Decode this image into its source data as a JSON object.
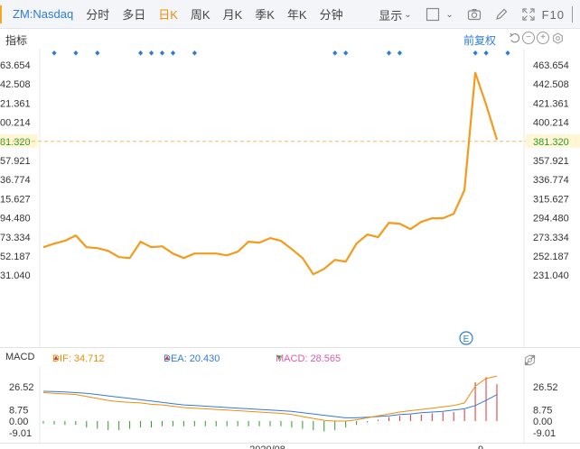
{
  "toolbar": {
    "symbol": "ZM:Nasdaq",
    "periods": [
      "分时",
      "多日",
      "日K",
      "周K",
      "月K",
      "季K",
      "年K",
      "分钟"
    ],
    "active_period": "日K",
    "show_label": "显示",
    "f10_label": "F10"
  },
  "indicator_row": {
    "label": "指标",
    "adjust_label": "前复权"
  },
  "price_axis": {
    "right_labels": [
      "463.654",
      "442.508",
      "421.361",
      "400.214",
      "381.320",
      "357.921",
      "336.774",
      "315.627",
      "294.480",
      "273.334",
      "252.187",
      "231.040"
    ],
    "left_labels": [
      "63.654",
      "42.508",
      "21.361",
      "00.214",
      "81.320",
      "57.921",
      "36.774",
      "15.627",
      "94.480",
      "73.334",
      "52.187",
      "31.040"
    ],
    "highlight_index": 4
  },
  "chart_data": {
    "type": "line",
    "title": "",
    "xlabel": "",
    "ylabel": "",
    "ylim": [
      222,
      472
    ],
    "current_price": 381.32,
    "x_tick_labels": [
      "2020/08",
      "9"
    ],
    "close": [
      262,
      266,
      269,
      275,
      262,
      261,
      258,
      251,
      250,
      268,
      262,
      263,
      255,
      250,
      255,
      255,
      255,
      253,
      257,
      268,
      267,
      272,
      269,
      260,
      250,
      232,
      238,
      248,
      246,
      266,
      276,
      273,
      289,
      288,
      282,
      290,
      294,
      294,
      299,
      325,
      455,
      420,
      381
    ],
    "dividend_markers": [
      0,
      2,
      4,
      8,
      9,
      10,
      11,
      13,
      26,
      27,
      31,
      32,
      39,
      40,
      42
    ],
    "macd_ylim": [
      -12,
      34
    ],
    "macd_tick_labels": [
      "26.52",
      "8.75",
      "0.00",
      "-9.01"
    ],
    "dif": [
      22,
      21.5,
      21,
      20.5,
      19,
      17.5,
      16,
      15,
      14.5,
      14,
      13,
      12.5,
      11.5,
      10.5,
      10,
      9.5,
      9,
      8.5,
      8,
      7.5,
      7,
      6.5,
      6,
      5,
      3.5,
      2,
      0.5,
      0,
      0,
      1,
      2.5,
      4,
      5.5,
      7,
      8,
      9,
      10,
      11,
      12,
      14,
      27,
      33,
      34.712
    ],
    "dea": [
      23,
      22.8,
      22.5,
      22,
      21.5,
      20.5,
      19.5,
      18.5,
      17.5,
      16.5,
      15.5,
      14.5,
      13.5,
      12.5,
      12,
      11.5,
      11,
      10.5,
      10,
      9.5,
      9,
      8.5,
      8,
      7.5,
      6.5,
      5.5,
      4.5,
      3.5,
      2.5,
      2.5,
      3,
      3.5,
      4,
      5,
      5.5,
      6.5,
      7,
      7.5,
      8.5,
      9.5,
      12,
      16,
      20.43
    ],
    "macd": [
      -2,
      -2.6,
      -3,
      -3,
      -5,
      -6,
      -7,
      -7,
      -6,
      -5,
      -5,
      -4,
      -4,
      -4,
      -4,
      -4,
      -4,
      -4,
      -4,
      -4,
      -4,
      -4,
      -4,
      -5,
      -6,
      -7,
      -8,
      -7,
      -5,
      -3,
      -1,
      1,
      3,
      4,
      5,
      5,
      6,
      7,
      7,
      9,
      30,
      34,
      28.565
    ]
  },
  "macd_header": {
    "title": "MACD",
    "dif_text": "DIF: 34.712",
    "dea_text": "DEA: 20.430",
    "macd_text": "MACD: 28.565",
    "dif_trend": "▲",
    "dea_trend": "▲",
    "macd_trend": "▼"
  },
  "colors": {
    "price_line": "#f59a1b",
    "dif": "#f08c0a",
    "dea": "#2f7bd8",
    "macd_up": "#e03030",
    "macd_down": "#2a9a2a",
    "marker": "#2f7bd8"
  },
  "icons": [
    "checkbox-icon",
    "camera-icon",
    "pen-icon",
    "fullscreen-icon",
    "reset-icon",
    "zoom-out-icon",
    "zoom-in-icon",
    "settings-icon",
    "event-e-icon"
  ]
}
